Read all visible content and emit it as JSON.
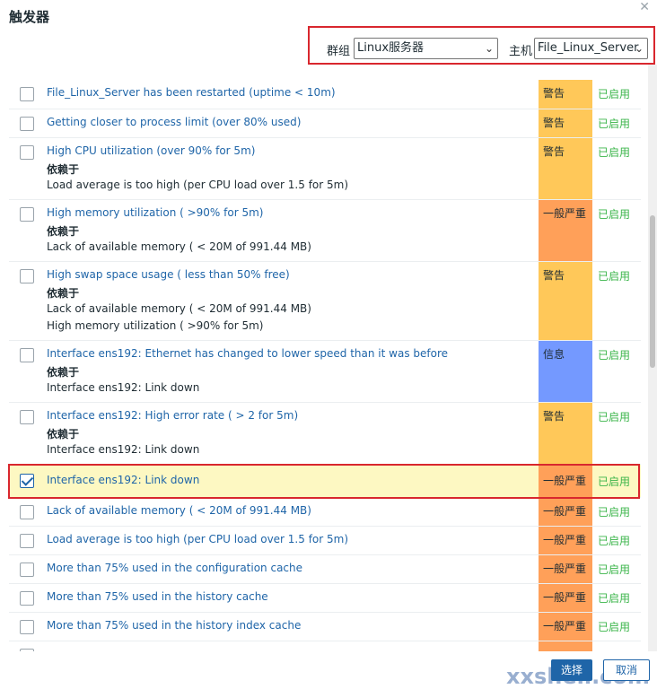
{
  "dialog": {
    "title": "触发器",
    "close_icon": "close-icon"
  },
  "filters": {
    "group_label": "群组",
    "group_value": "Linux服务器",
    "host_label": "主机",
    "host_value": "File_Linux_Server"
  },
  "colors": {
    "warning": "#ffc859",
    "average": "#ffa059",
    "info": "#7499ff",
    "enabled": "#3bb54a",
    "link": "#1f65a8",
    "highlight": "#d9272e"
  },
  "triggers": [
    {
      "name": "File_Linux_Server has been restarted (uptime < 10m)",
      "severity": "警告",
      "status": "已启用"
    },
    {
      "name": "Getting closer to process limit (over 80% used)",
      "severity": "警告",
      "status": "已启用"
    },
    {
      "name": "High CPU utilization (over 90% for 5m)",
      "depends_label": "依赖于",
      "depends": [
        "Load average is too high (per CPU load over 1.5 for 5m)"
      ],
      "severity": "警告",
      "status": "已启用"
    },
    {
      "name": "High memory utilization ( >90% for 5m)",
      "depends_label": "依赖于",
      "depends": [
        "Lack of available memory ( < 20M of 991.44 MB)"
      ],
      "severity": "一般严重",
      "status": "已启用"
    },
    {
      "name": "High swap space usage ( less than 50% free)",
      "depends_label": "依赖于",
      "depends": [
        "Lack of available memory ( < 20M of 991.44 MB)",
        "High memory utilization ( >90% for 5m)"
      ],
      "severity": "警告",
      "status": "已启用"
    },
    {
      "name": "Interface ens192: Ethernet has changed to lower speed than it was before",
      "depends_label": "依赖于",
      "depends": [
        "Interface ens192: Link down"
      ],
      "severity": "信息",
      "status": "已启用"
    },
    {
      "name": "Interface ens192: High error rate ( > 2 for 5m)",
      "depends_label": "依赖于",
      "depends": [
        "Interface ens192: Link down"
      ],
      "severity": "警告",
      "status": "已启用"
    },
    {
      "name": "Interface ens192: Link down",
      "severity": "一般严重",
      "status": "已启用",
      "checked": true
    },
    {
      "name": "Lack of available memory ( < 20M of 991.44 MB)",
      "severity": "一般严重",
      "status": "已启用"
    },
    {
      "name": "Load average is too high (per CPU load over 1.5 for 5m)",
      "severity": "一般严重",
      "status": "已启用"
    },
    {
      "name": "More than 75% used in the configuration cache",
      "severity": "一般严重",
      "status": "已启用"
    },
    {
      "name": "More than 75% used in the history cache",
      "severity": "一般严重",
      "status": "已启用"
    },
    {
      "name": "More than 75% used in the history index cache",
      "severity": "一般严重",
      "status": "已启用"
    }
  ],
  "footer": {
    "select_label": "选择",
    "cancel_label": "取消"
  },
  "watermark": "xxshell.com"
}
